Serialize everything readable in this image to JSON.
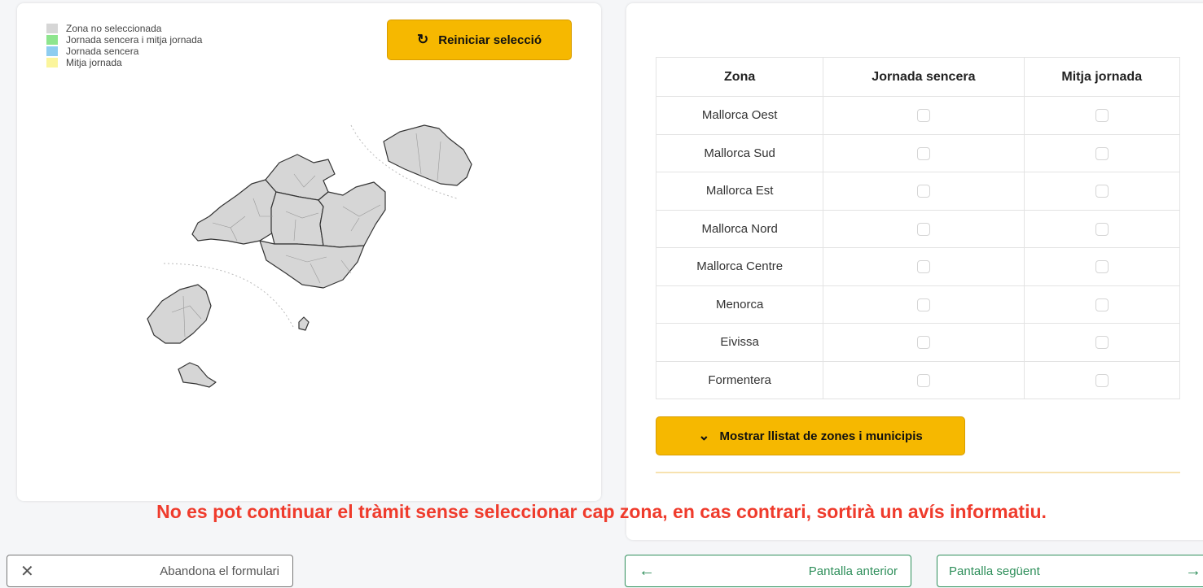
{
  "legend": [
    {
      "label": "Zona no seleccionada",
      "color": "#d6d6d6"
    },
    {
      "label": "Jornada sencera i mitja jornada",
      "color": "#8ee58e"
    },
    {
      "label": "Jornada sencera",
      "color": "#8ecdf0"
    },
    {
      "label": "Mitja jornada",
      "color": "#fbf59c"
    }
  ],
  "reset_button": {
    "label": "Reiniciar selecció",
    "icon": "refresh-icon"
  },
  "table": {
    "headers": [
      "Zona",
      "Jornada sencera",
      "Mitja jornada"
    ],
    "rows": [
      {
        "zona": "Mallorca Oest",
        "jornada_sencera": false,
        "mitja_jornada": false
      },
      {
        "zona": "Mallorca Sud",
        "jornada_sencera": false,
        "mitja_jornada": false
      },
      {
        "zona": "Mallorca Est",
        "jornada_sencera": false,
        "mitja_jornada": false
      },
      {
        "zona": "Mallorca Nord",
        "jornada_sencera": false,
        "mitja_jornada": false
      },
      {
        "zona": "Mallorca Centre",
        "jornada_sencera": false,
        "mitja_jornada": false
      },
      {
        "zona": "Menorca",
        "jornada_sencera": false,
        "mitja_jornada": false
      },
      {
        "zona": "Eivissa",
        "jornada_sencera": false,
        "mitja_jornada": false
      },
      {
        "zona": "Formentera",
        "jornada_sencera": false,
        "mitja_jornada": false
      }
    ]
  },
  "toggle_button": {
    "label": "Mostrar llistat de zones i municipis",
    "icon": "chevron-down-icon"
  },
  "warning": "No es pot continuar el tràmit sense seleccionar cap zona, en cas contrari, sortirà un avís informatiu.",
  "footer": {
    "abandon": {
      "label": "Abandona el formulari",
      "icon": "close-icon"
    },
    "previous": {
      "label": "Pantalla anterior",
      "icon": "arrow-left-icon"
    },
    "next": {
      "label": "Pantalla següent",
      "icon": "arrow-right-icon"
    }
  },
  "colors": {
    "accent": "#f6b800",
    "warning": "#ef3b2c",
    "nav_green": "#2f8f5b",
    "zone_fill": "#d6d6d6"
  }
}
